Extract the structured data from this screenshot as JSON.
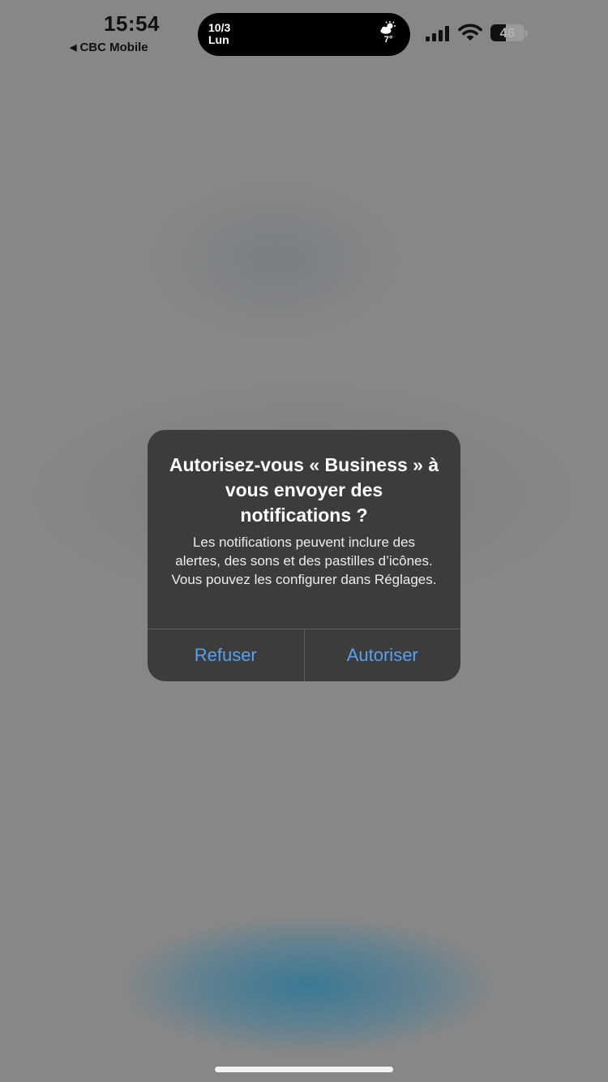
{
  "status_bar": {
    "time": "15:54",
    "back_label": "CBC Mobile",
    "battery_level": "46",
    "battery_fraction": 0.46
  },
  "dynamic_island": {
    "date": "10/3",
    "day": "Lun",
    "temperature": "7°",
    "weather_icon": "partly-cloudy-icon"
  },
  "alert": {
    "title": "Autorisez-vous « Business » à vous envoyer des notifications ?",
    "message": "Les notifications peuvent inclure des alertes, des sons et des pastilles d’icônes. Vous pouvez les configurer dans Réglages.",
    "deny_label": "Refuser",
    "allow_label": "Autoriser"
  },
  "colors": {
    "background": "#878787",
    "alert_background": "#3a3a3a",
    "button_text": "#5aa0ee"
  }
}
